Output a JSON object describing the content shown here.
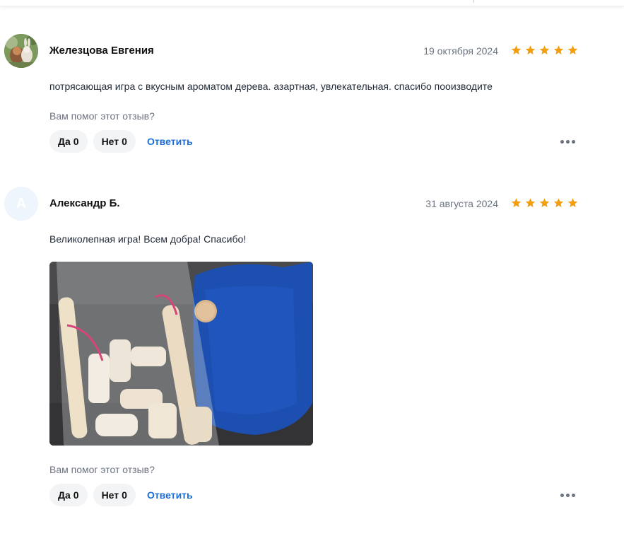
{
  "reviews": [
    {
      "author": "Железцова Евгения",
      "date": "19 октября 2024",
      "rating": 5,
      "text": "потрясающая игра с вкусным ароматом дерева. азартная, увлекательная. спасибо пооизводите",
      "helpful_prompt": "Вам помог этот отзыв?",
      "yes_label": "Да",
      "yes_count": "0",
      "no_label": "Нет",
      "no_count": "0",
      "reply_label": "Ответить"
    },
    {
      "author": "Александр Б.",
      "avatar_letter": "А",
      "date": "31 августа 2024",
      "rating": 5,
      "text": "Великолепная игра! Всем добра! Спасибо!",
      "helpful_prompt": "Вам помог этот отзыв?",
      "yes_label": "Да",
      "yes_count": "0",
      "no_label": "Нет",
      "no_count": "0",
      "reply_label": "Ответить"
    }
  ],
  "colors": {
    "star": "#f59e0b",
    "link": "#1a6ed8",
    "muted": "#6b7280",
    "pill": "#f3f4f6"
  },
  "icons": {
    "star": "star-icon",
    "more": "more-horizontal-icon"
  }
}
